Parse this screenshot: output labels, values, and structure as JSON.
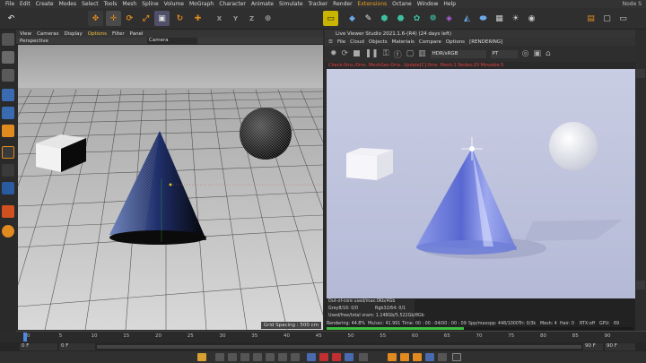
{
  "menu": [
    "File",
    "Edit",
    "Create",
    "Modes",
    "Select",
    "Tools",
    "Mesh",
    "Spline",
    "Volume",
    "MoGraph",
    "Character",
    "Animate",
    "Simulate",
    "Tracker",
    "Render",
    "Extensions",
    "Octane",
    "Window",
    "Help"
  ],
  "menu_right": "Node S",
  "viewport": {
    "menu": [
      "View",
      "Cameras",
      "Display",
      "Options",
      "Filter",
      "Panel"
    ],
    "name": "Perspective",
    "camera": "Camera",
    "grid_spacing": "Grid Spacing : 500 cm"
  },
  "liveviewer": {
    "title": "Live Viewer Studio 2021.1.6-(R4) (24 days left)",
    "menu": [
      "File",
      "Cloud",
      "Objects",
      "Materials",
      "Compare",
      "Options"
    ],
    "state": "[RENDERING]",
    "colorspace": "HDR/sRGB",
    "kernel": "PT",
    "status_line": "Check:0ms./0ms. MeshGen:0ms. Update[C]:0ms. Mesh:1 Nodes:20 Movable:5",
    "stats": {
      "out_of_core": "Out-of-core used/max:0Kb/4Gb",
      "grey": "Grey8/16: 0/0",
      "rgb": "Rgb32/64: 0/1",
      "vram": "Used/free/total vram: 1.148Gb/5.522Gb/8Gb",
      "rendering": "Rendering: 44.8%",
      "ms": "Ms/sec: 41.991",
      "time": "Time: 00 : 00 : 04/00 : 00 : 09",
      "spp": "Spp/maxspp: 448/1000",
      "tri": "Tri: 0/3k",
      "mesh": "Mesh: 4",
      "hair": "Hair: 0",
      "rtx": "RTX:off",
      "gpu": "GPU:",
      "gpu_val": "69"
    }
  },
  "timeline": {
    "ticks": [
      "0",
      "5",
      "10",
      "15",
      "20",
      "25",
      "30",
      "35",
      "40",
      "45",
      "50",
      "55",
      "60",
      "65",
      "70",
      "75",
      "80",
      "85",
      "90"
    ],
    "current": "0 F",
    "start": "0 F",
    "start2": "0 F",
    "end": "90 F",
    "end2": "90 F"
  },
  "colors": {
    "accent": "#f0a020",
    "render_bg": "#bfc3dc",
    "cone": "#5a67c9",
    "progress": "#3fbf3f"
  }
}
